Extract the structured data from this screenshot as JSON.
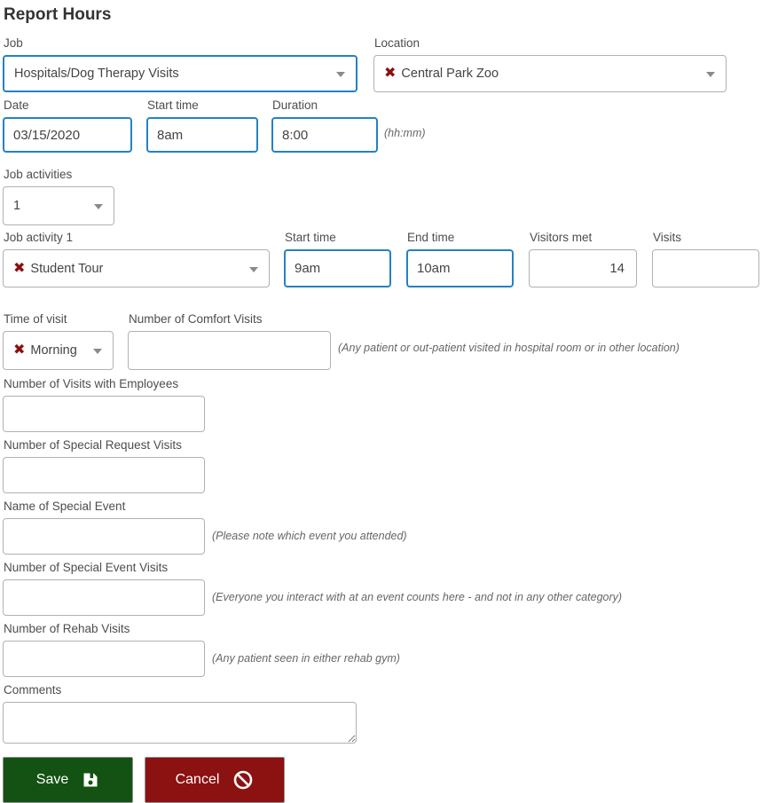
{
  "page": {
    "title": "Report Hours"
  },
  "form": {
    "job": {
      "label": "Job",
      "value": "Hospitals/Dog Therapy Visits"
    },
    "location": {
      "label": "Location",
      "value": "Central Park Zoo"
    },
    "date": {
      "label": "Date",
      "value": "03/15/2020"
    },
    "start_time": {
      "label": "Start time",
      "value": "8am"
    },
    "duration": {
      "label": "Duration",
      "value": "8:00",
      "hint": "(hh:mm)"
    },
    "job_activities": {
      "label": "Job activities",
      "value": "1"
    },
    "job_activity_1": {
      "label": "Job activity 1",
      "value": "Student Tour"
    },
    "activity_start_time": {
      "label": "Start time",
      "value": "9am"
    },
    "activity_end_time": {
      "label": "End time",
      "value": "10am"
    },
    "visitors_met": {
      "label": "Visitors met",
      "value": "14"
    },
    "visits": {
      "label": "Visits",
      "value": ""
    },
    "time_of_visit": {
      "label": "Time of visit",
      "value": "Morning"
    },
    "comfort_visits": {
      "label": "Number of Comfort Visits",
      "value": "",
      "hint": "(Any patient or out-patient visited in hospital room or in other location)"
    },
    "visits_with_employees": {
      "label": "Number of Visits with Employees",
      "value": ""
    },
    "special_request_visits": {
      "label": "Number of Special Request Visits",
      "value": ""
    },
    "special_event_name": {
      "label": "Name of Special Event",
      "value": "",
      "hint": "(Please note which event you attended)"
    },
    "special_event_visits": {
      "label": "Number of Special Event Visits",
      "value": "",
      "hint": "(Everyone you interact with at an event counts here - and not in any other category)"
    },
    "rehab_visits": {
      "label": "Number of Rehab Visits",
      "value": "",
      "hint": "(Any patient seen in either rehab gym)"
    },
    "comments": {
      "label": "Comments",
      "value": ""
    }
  },
  "buttons": {
    "save": "Save",
    "cancel": "Cancel"
  },
  "icons": {
    "clear_x": "✖",
    "save": "floppy-disk",
    "cancel": "prohibition-sign",
    "dropdown": "chevron-down"
  },
  "colors": {
    "focus_border": "#2581c4",
    "clear_x": "#8b0f0f",
    "save_bg": "#145214",
    "cancel_bg": "#8c1111"
  }
}
